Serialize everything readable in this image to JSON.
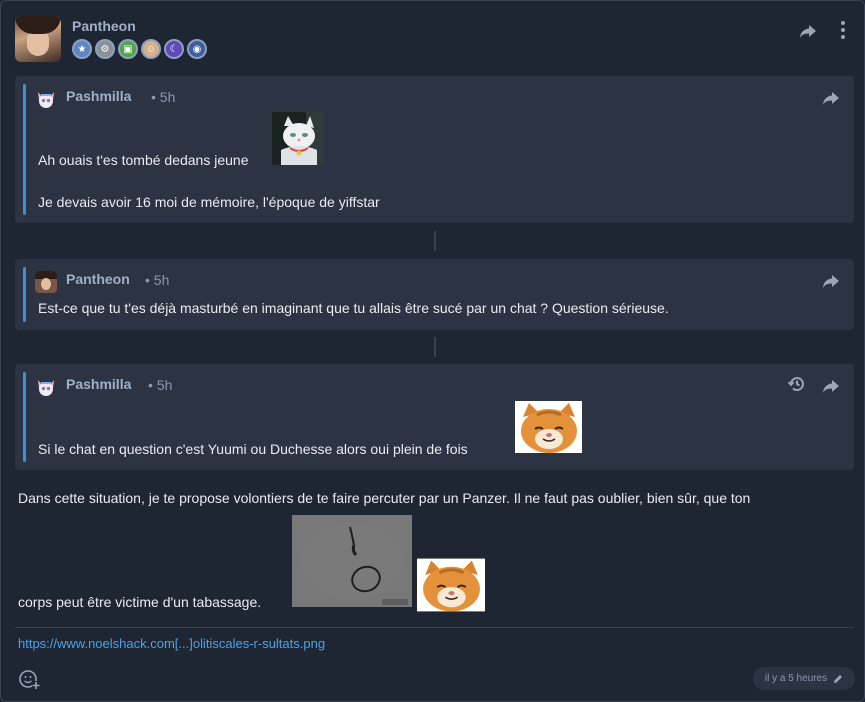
{
  "post": {
    "author": "Pantheon",
    "badges": [
      "star-badge",
      "gear-badge",
      "game-badge",
      "face-badge",
      "moon-badge",
      "planet-badge"
    ],
    "link": "https://www.noelshack.com[...]olitiscales-r-sultats.png",
    "timestamp": "il y a 5 heures",
    "body_line1": "Dans cette situation, je te propose volontiers de te faire percuter par un Panzer. Il ne faut pas oublier, bien sûr, que ton",
    "body_line2": "corps peut être victime d'un tabassage."
  },
  "quotes": [
    {
      "author": "Pashmilla",
      "time": "• 5h",
      "line1": "Ah ouais t'es tombé dedans jeune",
      "line2": "Je devais avoir 16 moi de mémoire, l'époque de yiffstar"
    },
    {
      "author": "Pantheon",
      "time": "• 5h",
      "line1": "Est-ce que tu t'es déjà masturbé en imaginant que tu allais être sucé par un chat ? Question sérieuse."
    },
    {
      "author": "Pashmilla",
      "time": "• 5h",
      "line1": "Si le chat en question c'est Yuumi ou Duchesse alors oui plein de fois"
    }
  ],
  "colors": {
    "background": "#1f2633",
    "quote_bg": "#2c3444",
    "accent": "#3d8fd6",
    "link": "#4aa3e8"
  }
}
